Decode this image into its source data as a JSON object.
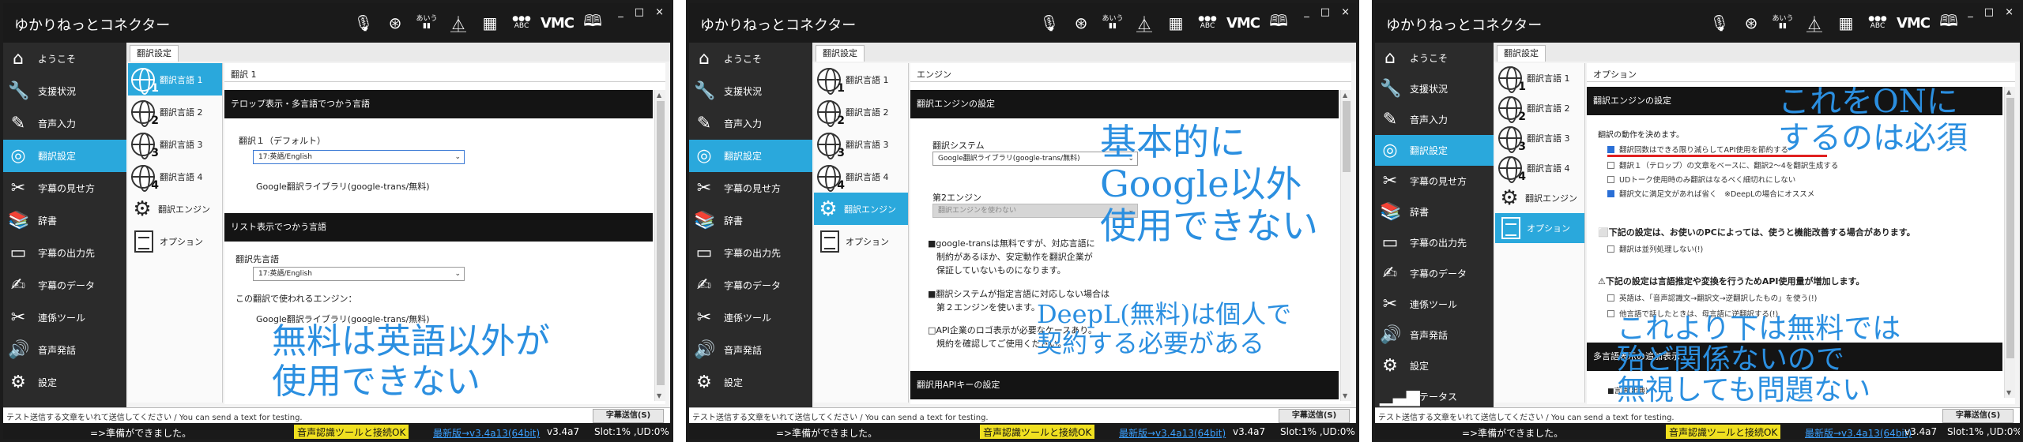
{
  "app_title": "ゆかりねっとコネクター",
  "toolbar_icons": [
    "microphone-icon",
    "swirl-icon",
    "audio-icon",
    "broadcast-tower-icon",
    "table-icon",
    "users-icon",
    "vmc-icon",
    "book-icon"
  ],
  "toolbar": {
    "audio_label": "あいう",
    "users_label": "ABC",
    "vmc_label": "VMC"
  },
  "window_controls": [
    "_",
    "□",
    "×"
  ],
  "sidebar_items": [
    {
      "label": "ようこそ",
      "icon": "home-icon"
    },
    {
      "label": "支援状況",
      "icon": "wrench-icon"
    },
    {
      "label": "音声入力",
      "icon": "pen-icon"
    },
    {
      "label": "翻訳設定",
      "icon": "translate-icon"
    },
    {
      "label": "字幕の見せ方",
      "icon": "tools-icon"
    },
    {
      "label": "辞書",
      "icon": "book-stack-icon"
    },
    {
      "label": "字幕の出力先",
      "icon": "film-icon"
    },
    {
      "label": "字幕のデータ",
      "icon": "script-icon"
    },
    {
      "label": "連係ツール",
      "icon": "tools-icon"
    },
    {
      "label": "音声発話",
      "icon": "speaker-icon"
    },
    {
      "label": "設定",
      "icon": "gears-icon"
    },
    {
      "label": "ステータス",
      "icon": "bar-chart-icon"
    }
  ],
  "tab_label": "翻訳設定",
  "sub_items": [
    {
      "label": "翻訳言語 1",
      "num": "1"
    },
    {
      "label": "翻訳言語 2",
      "num": "2"
    },
    {
      "label": "翻訳言語 3",
      "num": "3"
    },
    {
      "label": "翻訳言語 4",
      "num": "4"
    },
    {
      "label": "翻訳エンジン"
    },
    {
      "label": "オプション"
    }
  ],
  "panel1": {
    "content_title": "翻訳 1",
    "section1": "テロップ表示・多言語でつかう言語",
    "default_label": "翻訳１（デフォルト）",
    "lang_select": "17:英語/English",
    "engine_text": "Google翻訳ライブラリ(google-trans/無料)",
    "section2": "リスト表示でつかう言語",
    "target_label": "翻訳先言語",
    "target_select": "17:英語/English",
    "engine_label": "この翻訳で使われるエンジン：",
    "engine_text2": "Google翻訳ライブラリ(google-trans/無料)",
    "overlay": [
      "無料は英語以外が",
      "使用できない"
    ]
  },
  "panel2": {
    "content_title": "エンジン",
    "section1": "翻訳エンジンの設定",
    "system_label": "翻訳システム",
    "system_select": "Google翻訳ライブラリ(google-trans/無料)",
    "second_label": "第2エンジン",
    "second_select": "翻訳エンジンを使わない",
    "note1": [
      "■google-transは無料ですが、対応言語に",
      "　制約があるほか、安定動作を翻訳企業が",
      "　保証していないものになります。"
    ],
    "note2": [
      "■翻訳システムが指定言語に対応しない場合は",
      "　第２エンジンを使います。"
    ],
    "note3": [
      "□API企業のロゴ表示が必要なケースあり。",
      "　規約を確認してご使用ください。"
    ],
    "section2": "翻訳用APIキーの設定",
    "overlay1": [
      "基本的に",
      "Google以外",
      "使用できない"
    ],
    "overlay2": [
      "DeepL(無料)は個人で",
      "契約する必要がある"
    ]
  },
  "panel3": {
    "content_title": "オプション",
    "section1": "翻訳エンジンの設定",
    "decide_label": "翻訳の動作を決めます。",
    "checks": [
      {
        "label": "翻訳回数はできる限り減らしてAPI使用を節約する",
        "on": true
      },
      {
        "label": "翻訳１（テロップ）の文章をベースに、翻訳2〜4を翻訳生成する",
        "on": false
      },
      {
        "label": "UDトーク使用時のみ翻訳はなるべく細切れにしない",
        "on": false
      },
      {
        "label": "翻訳文に満足文があれば省く　※DeepLの場合にオススメ",
        "on": true
      }
    ],
    "warn1": "⬜下記の設定は、お使いのPCによっては、使うと機能改善する場合があります。",
    "warn1_check": "翻訳は並列処理しない(!)",
    "warn2": "⚠下記の設定は言語推定や変換を行うためAPI使用量が増加します。",
    "warn2_checks": [
      "英語は、「音声認識文→翻訳文→逆翻訳したもの」を使う(!)",
      "他言語で話したときは、母言語に逆翻訳する(!)"
    ],
    "section2": "多言語表示の追加表示",
    "cut_label": "■言語(出典)",
    "overlay1": [
      "これをONに",
      "するのは必須"
    ],
    "overlay2": [
      "これより下は無料では",
      "殆ど関係ないので",
      "無視しても問題ない"
    ]
  },
  "bottombar": {
    "test_placeholder": "テスト送信する文章をいれて送信してください / You can send a text for testing.",
    "send_button": "字幕送信(S)"
  },
  "status": {
    "ready": "=>準備ができました。",
    "connected": "音声認識ツールと接続OK",
    "update": "最新版→v3.4a13(64bit)",
    "version": "v3.4a7",
    "slot": "Slot:1% ,UD:0%"
  },
  "colors": {
    "accent": "#2aa8dc",
    "overlay": "#2b8fe0",
    "status_highlight": "#f0e020",
    "header": "#141414"
  }
}
